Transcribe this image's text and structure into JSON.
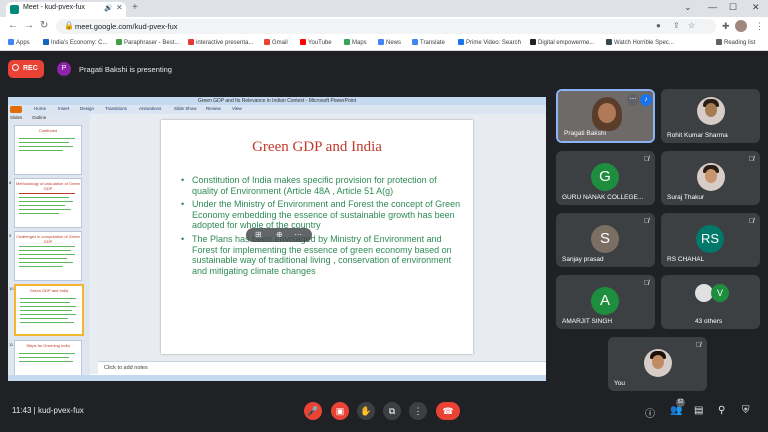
{
  "browser": {
    "tab_title": "Meet - kud-pvex-fux",
    "url": "meet.google.com/kud-pvex-fux",
    "bookmarks": [
      "Apps",
      "India's Economy: C...",
      "Paraphraser - Best...",
      "interactive presenta...",
      "Gmail",
      "YouTube",
      "Maps",
      "News",
      "Translate",
      "Prime Video: Search",
      "Digital empowerme...",
      "Watch Horrible Spec...",
      "Reading list"
    ]
  },
  "meet": {
    "rec_label": "REC",
    "presenter_initial": "P",
    "presenter_text": "Pragati Bakshi is presenting",
    "meeting_time": "11:43",
    "meeting_code": "kud-pvex-fux",
    "participants_badge": "52"
  },
  "powerpoint": {
    "window_title": "Green GDP and Its Relevance in Indian Context - Microsoft PowerPoint",
    "ribbon_tabs": [
      "Home",
      "Insert",
      "Design",
      "Transitions",
      "Animations",
      "Slide Show",
      "Review",
      "View"
    ],
    "panel_tabs": [
      "Slides",
      "Outline"
    ],
    "thumb_titles": [
      "Continued",
      "Methodology of calculation of Green GDP",
      "Challenges in computation of Green GDP",
      "Green GDP and India",
      "Steps for Greening India"
    ],
    "thumb_numbers": [
      "",
      "8",
      "9",
      "10",
      "11"
    ],
    "notes_placeholder": "Click to add notes"
  },
  "slide": {
    "title": "Green GDP and India",
    "bullets": [
      "Constitution of India makes specific provision for protection of  quality of Environment (Article 48A , Article 51 A(g)",
      "Under the  Ministry of Environment and Forest the concept of Green Economy embedding the essence of sustainable growth has been adopted for whole  of the country",
      "The  Plans has been  envisaged by Ministry of Environment and Forest for implementing the essence of green economy based on sustainable way of traditional living , conservation of environment and mitigating climate changes"
    ]
  },
  "participants": [
    {
      "name": "Pragati Bakshi"
    },
    {
      "name": "Rohit Kumar Sharma"
    },
    {
      "name": "GURU NANAK COLLEGE...",
      "initial": "G",
      "color": "#1e8e3e"
    },
    {
      "name": "Suraj Thakur"
    },
    {
      "name": "Sanjay prasad",
      "initial": "S",
      "color": "#7b6f63"
    },
    {
      "name": "RS CHAHAL",
      "initial": "RS",
      "color": "#00796b"
    },
    {
      "name": "AMARJIT SINGH",
      "initial": "A",
      "color": "#1e8e3e"
    },
    {
      "name": "43 others",
      "initial": "V",
      "color": "#1e8e3e"
    },
    {
      "name": "You"
    }
  ]
}
